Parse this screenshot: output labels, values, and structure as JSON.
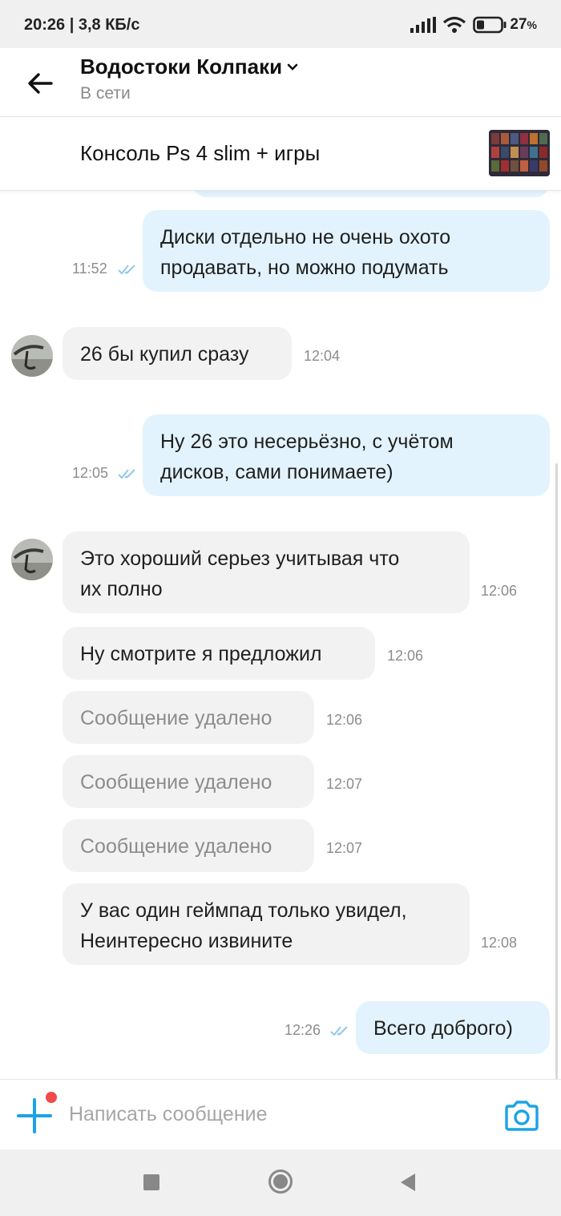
{
  "status_bar": {
    "time_speed": "20:26 | 3,8 КБ/с",
    "battery": "27"
  },
  "header": {
    "contact_name": "Водостоки Колпаки",
    "contact_status": "В сети"
  },
  "listing": {
    "title": "Консоль Ps 4 slim + игры"
  },
  "messages": [
    {
      "direction": "out",
      "lines": [
        "Диски отдельно не очень охото",
        "продавать, но можно подумать"
      ],
      "time": "11:52"
    },
    {
      "direction": "in",
      "lines": [
        "26 бы купил сразу"
      ],
      "time": "12:04"
    },
    {
      "direction": "out",
      "lines": [
        "Ну 26 это несерьёзно, с учётом",
        "дисков, сами понимаете)"
      ],
      "time": "12:05"
    },
    {
      "direction": "in",
      "lines": [
        "Это хороший серьез учитывая что",
        "их полно"
      ],
      "time": "12:06"
    },
    {
      "direction": "in",
      "lines": [
        "Ну смотрите я предложил"
      ],
      "time": "12:06"
    },
    {
      "direction": "in",
      "lines": [
        "Сообщение удалено"
      ],
      "time": "12:06",
      "deleted": true
    },
    {
      "direction": "in",
      "lines": [
        "Сообщение удалено"
      ],
      "time": "12:07",
      "deleted": true
    },
    {
      "direction": "in",
      "lines": [
        "Сообщение удалено"
      ],
      "time": "12:07",
      "deleted": true
    },
    {
      "direction": "in",
      "lines": [
        "У вас один геймпад только увидел,",
        "Неинтересно извините"
      ],
      "time": "12:08"
    },
    {
      "direction": "out",
      "lines": [
        "Всего доброго)"
      ],
      "time": "12:26"
    }
  ],
  "composer": {
    "placeholder": "Написать сообщение"
  },
  "colors": {
    "accent": "#1ba3e6",
    "outgoing_bubble": "#e3f3fd",
    "incoming_bubble": "#f2f2f2",
    "notification_dot": "#f04a4a"
  },
  "icons": [
    "back-arrow-icon",
    "chevron-down-icon",
    "double-check-icon",
    "plus-icon",
    "camera-icon",
    "signal-icon",
    "wifi-icon",
    "battery-icon"
  ]
}
